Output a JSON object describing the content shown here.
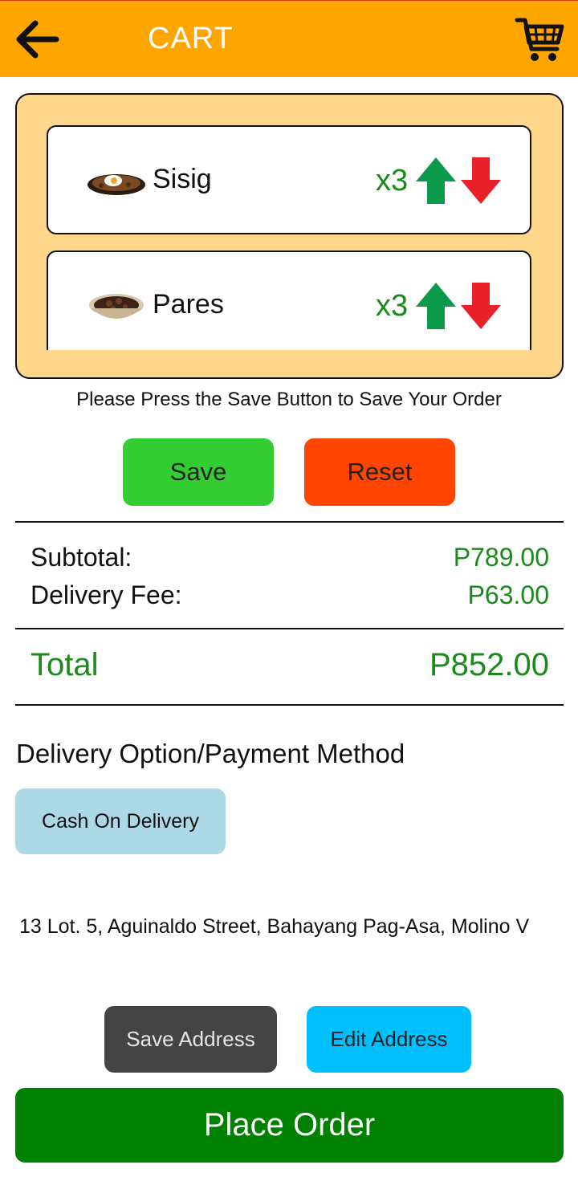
{
  "header": {
    "title": "CART"
  },
  "cart": {
    "items": [
      {
        "name": "Sisig",
        "qty": "x3"
      },
      {
        "name": "Pares",
        "qty": "x3"
      }
    ]
  },
  "save_hint": "Please Press the Save Button to Save Your Order",
  "actions": {
    "save_label": "Save",
    "reset_label": "Reset"
  },
  "summary": {
    "subtotal_label": "Subtotal:",
    "subtotal_value": "P789.00",
    "delivery_label": "Delivery Fee:",
    "delivery_value": "P63.00",
    "total_label": "Total",
    "total_value": "P852.00"
  },
  "delivery": {
    "section_title": "Delivery Option/Payment Method",
    "method_label": "Cash On Delivery",
    "address": "13 Lot. 5, Aguinaldo Street, Bahayang Pag-Asa, Molino V"
  },
  "address_actions": {
    "save_label": "Save Address",
    "edit_label": "Edit Address"
  },
  "place_order_label": "Place Order",
  "colors": {
    "header": "#FFA500",
    "panel": "#FFD68A",
    "save": "#33CC33",
    "reset": "#FF4500",
    "money": "#1a8a1a",
    "cod": "#ADD8E6",
    "save_address": "#444444",
    "edit_address": "#00BFFF",
    "place_order": "#008000"
  }
}
